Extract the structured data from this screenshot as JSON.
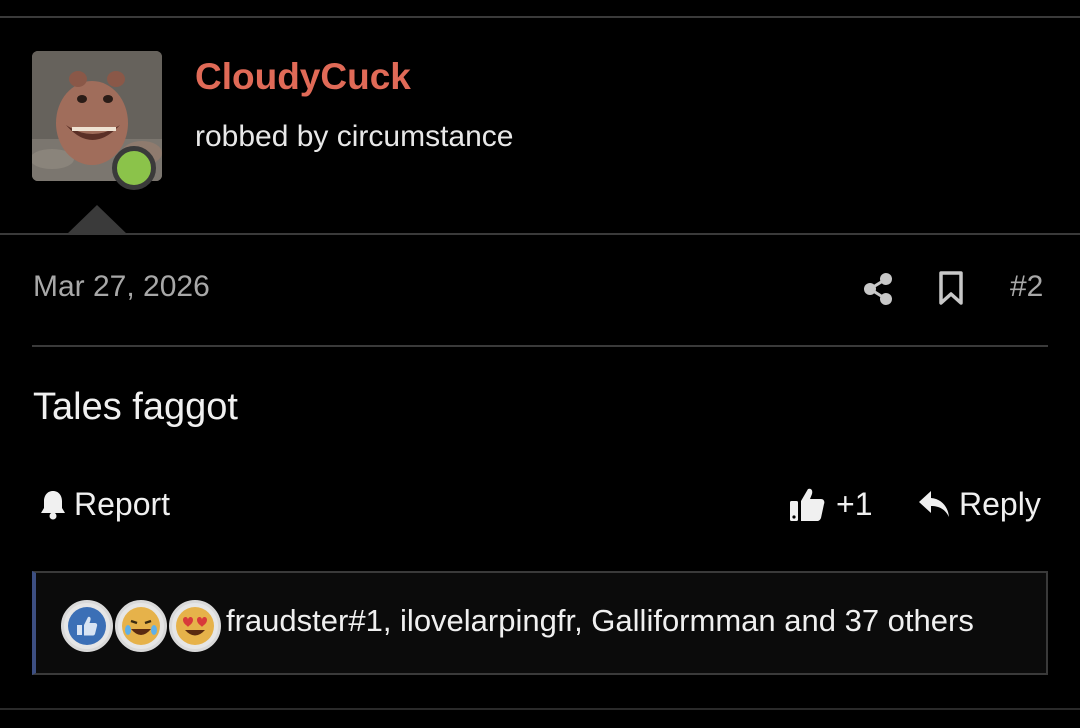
{
  "post": {
    "username": "CloudyCuck",
    "user_title": "robbed by circumstance",
    "date": "Mar 27, 2026",
    "post_number": "#2",
    "body": "Tales faggot",
    "actions": {
      "report_label": "Report",
      "like_count": "+1",
      "reply_label": "Reply"
    },
    "reactions": {
      "icons": [
        "like-reaction",
        "laugh-cry-reaction",
        "love-eyes-reaction"
      ],
      "summary": "fraudster#1, ilovelarpingfr, Galliformman and 37 others"
    }
  },
  "colors": {
    "background": "#000000",
    "username": "#e06a57",
    "online": "#8bc34a",
    "divider": "#3a3a3a",
    "reaction_accent": "#3d4f82"
  }
}
